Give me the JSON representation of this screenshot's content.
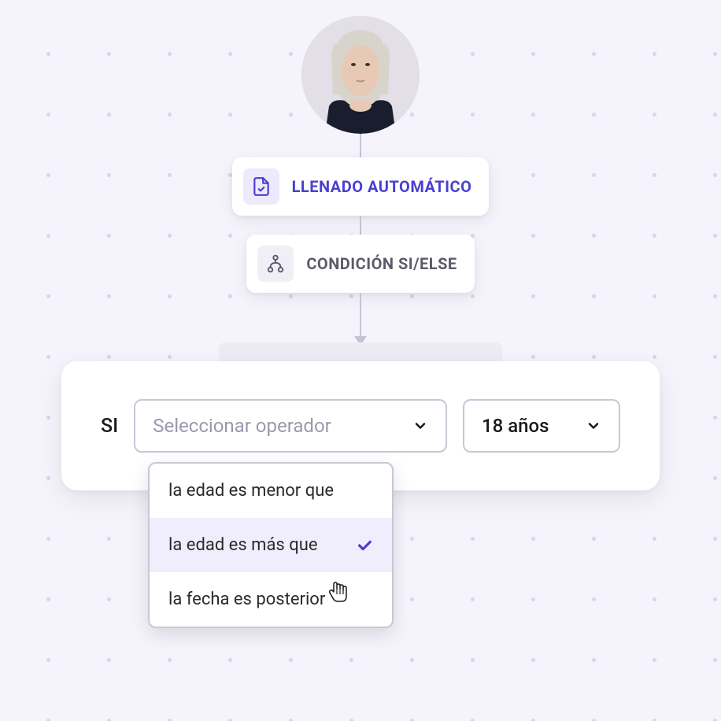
{
  "flow": {
    "autofill_label": "LLENADO AUTOMÁTICO",
    "condition_label": "CONDICIÓN SI/ELSE"
  },
  "condition": {
    "si_label": "SI",
    "operator_placeholder": "Seleccionar operador",
    "value_selected": "18 años",
    "operator_options": [
      "la edad es menor que",
      "la edad es más que",
      "la fecha es posterior"
    ],
    "selected_index": 1
  },
  "colors": {
    "primary": "#4a3fcf",
    "bg": "#f5f4fc"
  }
}
